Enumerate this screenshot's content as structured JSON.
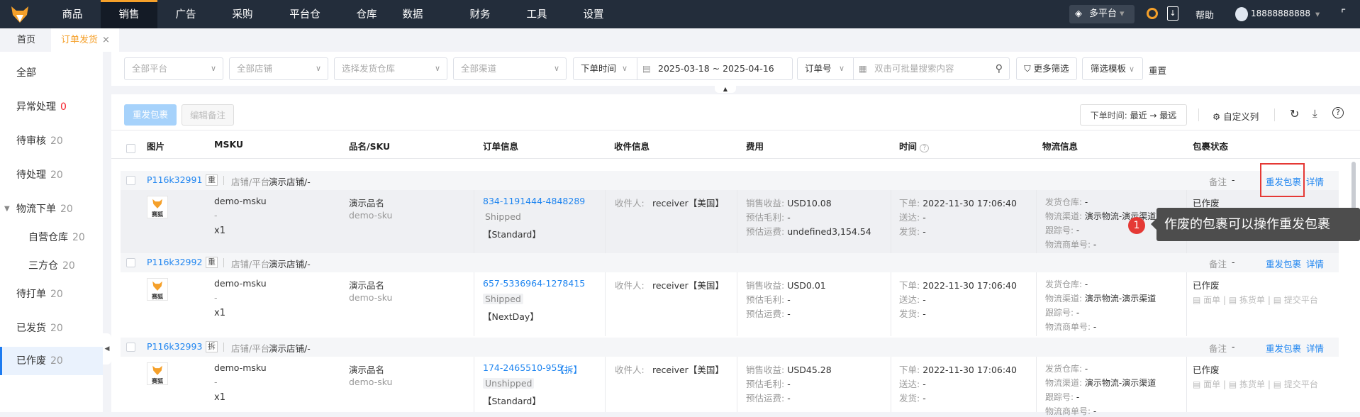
{
  "topnav": {
    "items": [
      "商品",
      "销售",
      "广告",
      "采购",
      "平台仓",
      "仓库",
      "数据",
      "财务",
      "工具",
      "设置"
    ],
    "active_index": 1,
    "platform": "多平台",
    "help": "帮助",
    "user": "18888888888"
  },
  "tabs": {
    "home": "首页",
    "current": "订单发货",
    "close": "×"
  },
  "sidebar": {
    "items": [
      {
        "label": "全部",
        "count": ""
      },
      {
        "label": "异常处理",
        "count": "0"
      },
      {
        "label": "待审核",
        "count": "20"
      },
      {
        "label": "待处理",
        "count": "20"
      },
      {
        "label": "物流下单",
        "count": "20"
      },
      {
        "label": "自营仓库",
        "count": "20"
      },
      {
        "label": "三方仓",
        "count": "20"
      },
      {
        "label": "待打单",
        "count": "20"
      },
      {
        "label": "已发货",
        "count": "20"
      },
      {
        "label": "已作废",
        "count": "20"
      }
    ],
    "selected_index": 9
  },
  "filters": {
    "platform": "全部平台",
    "shop": "全部店铺",
    "warehouse": "选择发货仓库",
    "channel": "全部渠道",
    "time_type": "下单时间",
    "date_start": "2025-03-18",
    "date_sep": "~",
    "date_end": "2025-04-16",
    "search_type": "订单号",
    "search_placeholder": "双击可批量搜索内容",
    "more": "更多筛选",
    "template": "筛选模板",
    "reset": "重置"
  },
  "toolbar": {
    "resend": "重发包裹",
    "edit_note": "编辑备注",
    "sort_label": "下单时间:",
    "sort_value": "最近 → 最远",
    "custom_cols": "自定义列"
  },
  "columns": [
    "图片",
    "MSKU",
    "品名/SKU",
    "订单信息",
    "收件信息",
    "费用",
    "时间",
    "物流信息",
    "包裹状态"
  ],
  "labels": {
    "shop_platform": "店铺/平台",
    "note": "备注",
    "resend": "重发包裹",
    "detail": "详情",
    "receiver": "收件人:",
    "sales": "销售收益:",
    "profit": "预估毛利:",
    "shipping": "预估运费:",
    "order_time": "下单:",
    "delivered": "送达:",
    "shipped": "发货:",
    "warehouse": "发货仓库:",
    "channel": "物流渠道:",
    "tracking": "跟踪号:",
    "carrier_no": "物流商单号:",
    "waybill": "面单",
    "picklist": "拣货单",
    "submit": "提交平台",
    "logo_text": "赛狐"
  },
  "rows": [
    {
      "package": "P116k32991",
      "badge": "重",
      "shop": "演示店铺/-",
      "note": "-",
      "msku": "demo-msku",
      "msku_sub": "-",
      "qty": "x1",
      "product": "演示品名",
      "sku": "demo-sku",
      "order_no": "834-1191444-4848289",
      "order_extra": "",
      "order_status": "Shipped",
      "service": "【Standard】",
      "receiver": "receiver【美国】",
      "sales": "USD10.08",
      "profit": "-",
      "shipping": "undefined3,154.54",
      "order_time": "2022-11-30 17:06:40",
      "delivered": "-",
      "shipped": "-",
      "warehouse": "-",
      "channel": "演示物流-演示渠道",
      "tracking": "-",
      "carrier_no": "-",
      "status": "已作废"
    },
    {
      "package": "P116k32992",
      "badge": "重",
      "shop": "演示店铺/-",
      "note": "-",
      "msku": "demo-msku",
      "msku_sub": "-",
      "qty": "x1",
      "product": "演示品名",
      "sku": "demo-sku",
      "order_no": "657-5336964-1278415",
      "order_extra": "",
      "order_status": "Shipped",
      "service": "【NextDay】",
      "receiver": "receiver【美国】",
      "sales": "USD0.01",
      "profit": "-",
      "shipping": "-",
      "order_time": "2022-11-30 17:06:40",
      "delivered": "-",
      "shipped": "-",
      "warehouse": "-",
      "channel": "演示物流-演示渠道",
      "tracking": "-",
      "carrier_no": "-",
      "status": "已作废"
    },
    {
      "package": "P116k32993",
      "badge": "拆",
      "shop": "演示店铺/-",
      "note": "-",
      "msku": "demo-msku",
      "msku_sub": "-",
      "qty": "x1",
      "product": "演示品名",
      "sku": "demo-sku",
      "order_no": "174-2465510-955...",
      "order_extra": "【拆】",
      "order_status": "Unshipped",
      "service": "【Standard】",
      "receiver": "receiver【美国】",
      "sales": "USD45.28",
      "profit": "-",
      "shipping": "-",
      "order_time": "2022-11-30 17:06:40",
      "delivered": "-",
      "shipped": "-",
      "warehouse": "-",
      "channel": "演示物流-演示渠道",
      "tracking": "-",
      "carrier_no": "-",
      "status": "已作废"
    }
  ],
  "tooltip": {
    "step": "1",
    "text": "作废的包裹可以操作重发包裹"
  },
  "colors": {
    "nav_bg": "#232d3b",
    "accent_orange": "#f5a02a",
    "link_blue": "#1f85f0",
    "highlight_red": "#e53935"
  }
}
